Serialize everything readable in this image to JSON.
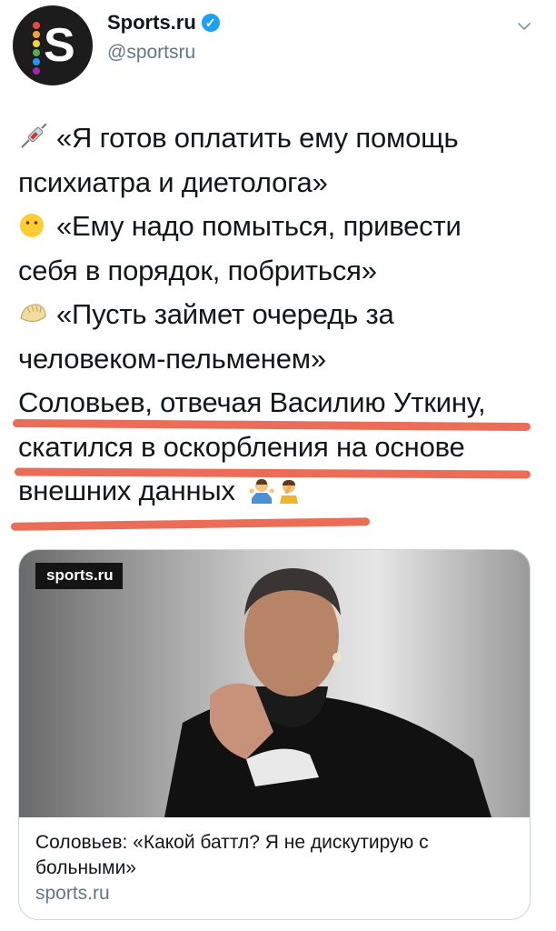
{
  "header": {
    "account_name": "Sports.ru",
    "handle": "@sportsru",
    "avatar_letter": "S",
    "verified_glyph": "✓"
  },
  "tweet": {
    "lines": [
      "«Я готов оплатить ему помощь",
      "психиатра и диетолога»",
      "«Ему надо помыться, привести",
      "себя в порядок, побриться»",
      "«Пусть займет очередь за",
      "человеком-пельменем»",
      "Соловьев, отвечая Василию Уткину,",
      "скатился в оскорбления на основе",
      "внешних данных"
    ],
    "emojis": [
      "syringe-icon",
      "hushed-face-icon",
      "dumpling-icon",
      "shrugging-man-icon",
      "facepalm-man-icon"
    ],
    "underline_color": "#e9543a"
  },
  "card": {
    "badge": "sports.ru",
    "title": "Соловьев: «Какой баттл? Я не дискутирую с больными»",
    "domain": "sports.ru"
  },
  "colors": {
    "text": "#14171a",
    "secondary": "#657786",
    "verified": "#1da1f2",
    "border": "#ccd6dd"
  }
}
